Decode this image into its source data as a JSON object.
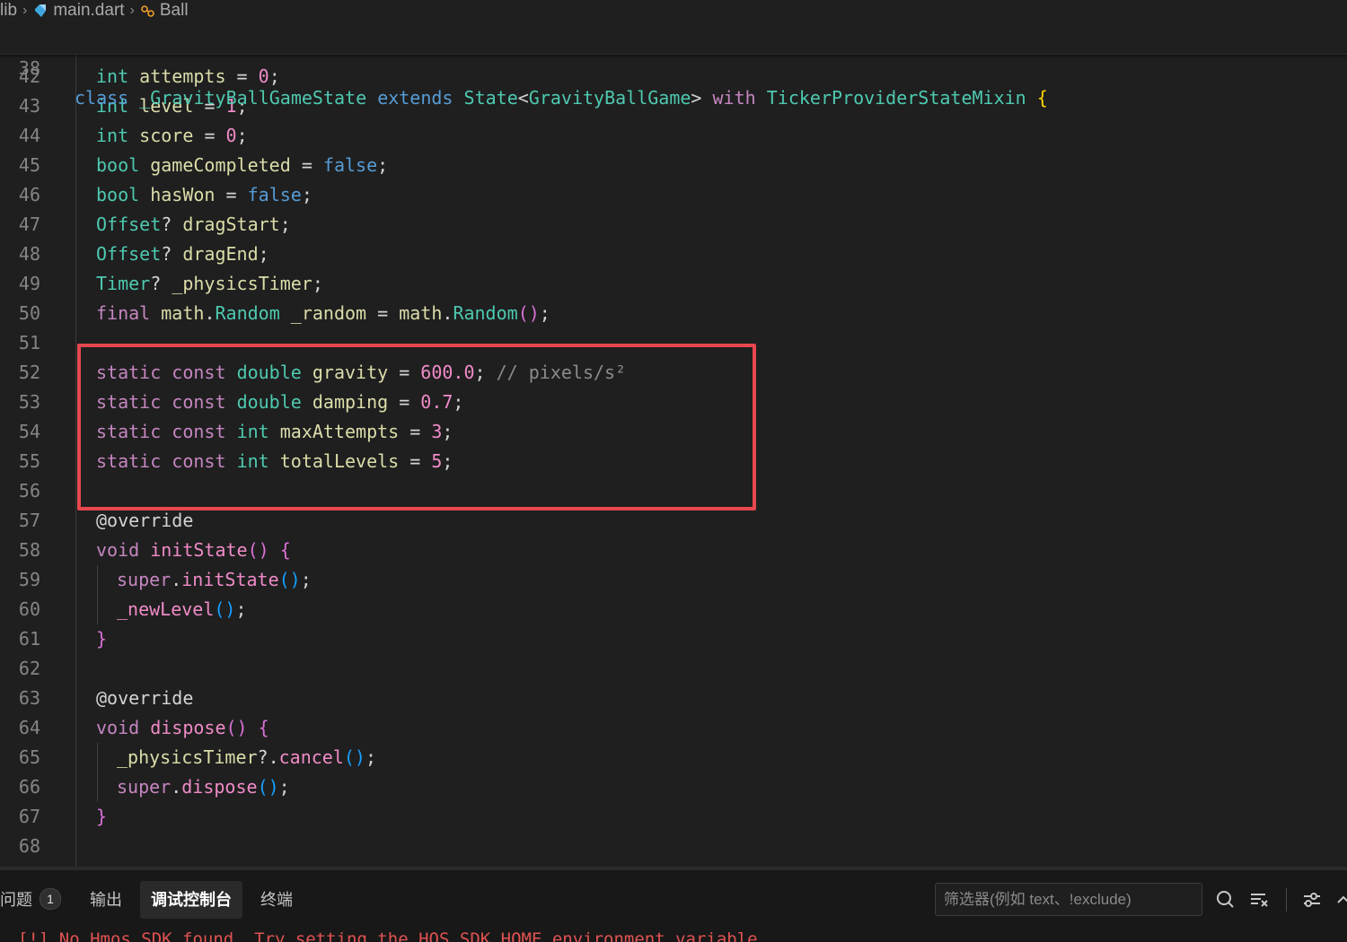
{
  "breadcrumb": {
    "items": [
      "lib",
      "main.dart",
      "Ball"
    ]
  },
  "editor": {
    "sticky_line": {
      "number": "38",
      "text": "class _GravityBallGameState extends State<GravityBallGame> with TickerProviderStateMixin {"
    },
    "lines": [
      {
        "n": "42",
        "text": "  int attempts = 0;"
      },
      {
        "n": "43",
        "text": "  int level = 1;"
      },
      {
        "n": "44",
        "text": "  int score = 0;"
      },
      {
        "n": "45",
        "text": "  bool gameCompleted = false;"
      },
      {
        "n": "46",
        "text": "  bool hasWon = false;"
      },
      {
        "n": "47",
        "text": "  Offset? dragStart;"
      },
      {
        "n": "48",
        "text": "  Offset? dragEnd;"
      },
      {
        "n": "49",
        "text": "  Timer? _physicsTimer;"
      },
      {
        "n": "50",
        "text": "  final math.Random _random = math.Random();"
      },
      {
        "n": "51",
        "text": ""
      },
      {
        "n": "52",
        "text": "  static const double gravity = 600.0; // pixels/s²"
      },
      {
        "n": "53",
        "text": "  static const double damping = 0.7;"
      },
      {
        "n": "54",
        "text": "  static const int maxAttempts = 3;"
      },
      {
        "n": "55",
        "text": "  static const int totalLevels = 5;"
      },
      {
        "n": "56",
        "text": ""
      },
      {
        "n": "57",
        "text": "  @override"
      },
      {
        "n": "58",
        "text": "  void initState() {"
      },
      {
        "n": "59",
        "text": "    super.initState();"
      },
      {
        "n": "60",
        "text": "    _newLevel();"
      },
      {
        "n": "61",
        "text": "  }"
      },
      {
        "n": "62",
        "text": ""
      },
      {
        "n": "63",
        "text": "  @override"
      },
      {
        "n": "64",
        "text": "  void dispose() {"
      },
      {
        "n": "65",
        "text": "    _physicsTimer?.cancel();"
      },
      {
        "n": "66",
        "text": "    super.dispose();"
      },
      {
        "n": "67",
        "text": "  }"
      },
      {
        "n": "68",
        "text": ""
      }
    ]
  },
  "panel": {
    "tabs": [
      {
        "label": "问题",
        "badge": "1"
      },
      {
        "label": "输出"
      },
      {
        "label": "调试控制台",
        "active": true
      },
      {
        "label": "终端"
      }
    ],
    "filter_placeholder": "筛选器(例如 text、!exclude)",
    "console_message": "[!] No Hmos SDK found. Try setting the HOS_SDK_HOME environment variable."
  },
  "colors": {
    "highlight_box": "#e8474f",
    "background": "#1f1f1f"
  },
  "icons": {
    "dart_file": "dart-icon",
    "class_symbol": "class-icon",
    "search": "search-icon",
    "clear": "clear-output-icon",
    "settings": "filter-settings-icon",
    "chevron": "chevron-up-icon"
  }
}
